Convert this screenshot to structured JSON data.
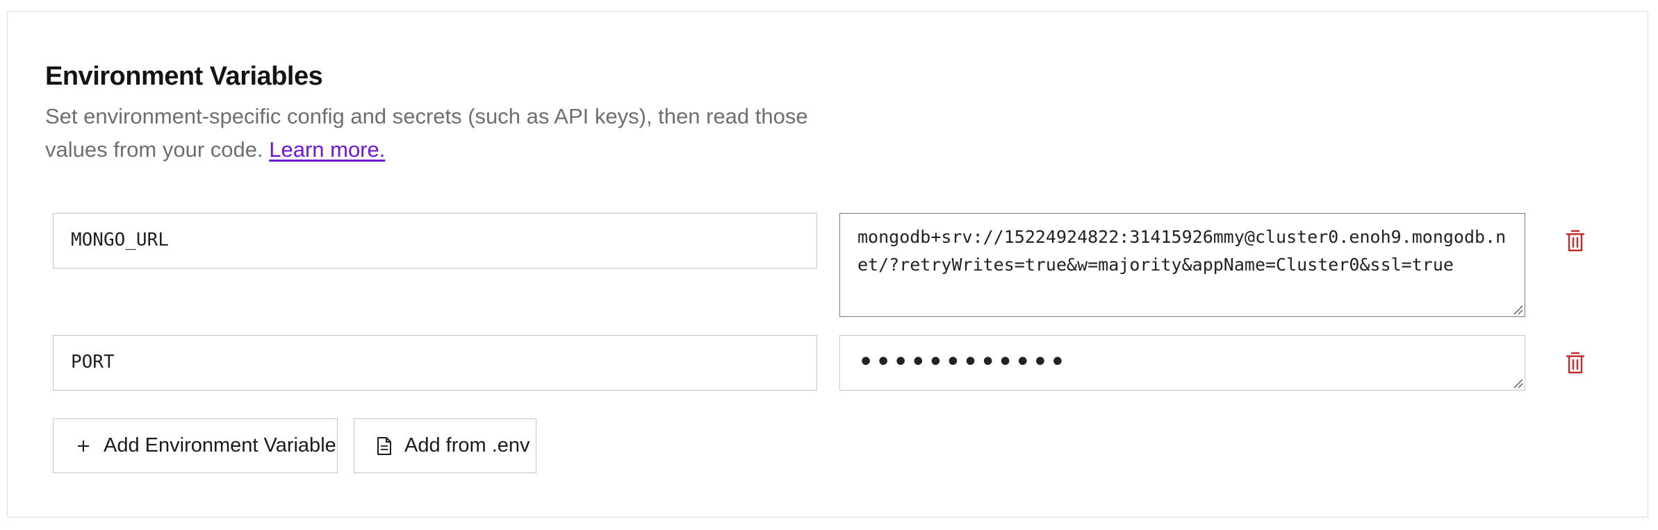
{
  "section": {
    "title": "Environment Variables",
    "description": "Set environment-specific config and secrets (such as API keys), then read those values from your code.",
    "learn_more_label": "Learn more."
  },
  "env_vars": [
    {
      "key": "MONGO_URL",
      "value": "mongodb+srv://15224924822:31415926mmy@cluster0.enoh9.mongodb.net/?retryWrites=true&w=majority&appName=Cluster0&ssl=true"
    },
    {
      "key": "PORT",
      "value_masked": "••••••••••••"
    }
  ],
  "actions": {
    "add_variable_label": "Add Environment Variable",
    "add_from_env_label": "Add from .env"
  },
  "icons": {
    "delete": "trash-icon",
    "add": "plus-icon",
    "file": "file-icon",
    "resize": "resize-grip-icon"
  },
  "colors": {
    "link": "#6f16d6",
    "delete": "#c62828",
    "text": "#141414",
    "muted": "#6e6e6e",
    "border": "#c4c4c4"
  }
}
